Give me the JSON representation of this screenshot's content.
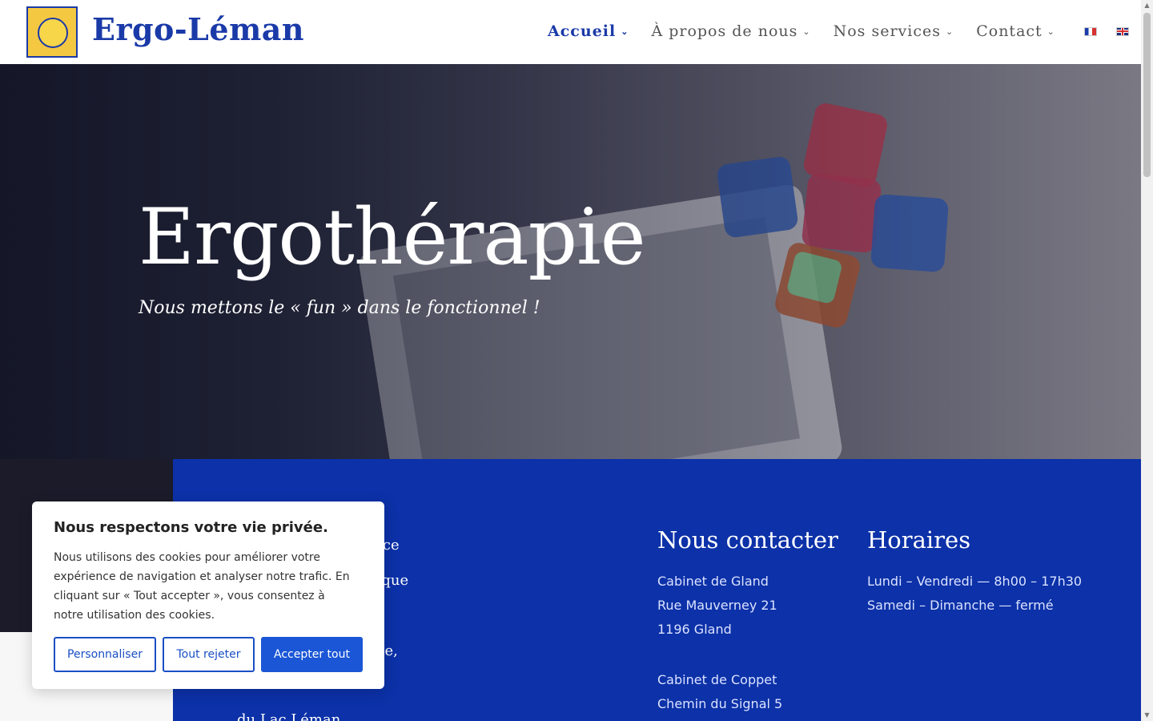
{
  "header": {
    "logo_text": "Ergo-Léman",
    "nav": [
      {
        "label": "Accueil",
        "active": true
      },
      {
        "label": "À propos de nous",
        "active": false
      },
      {
        "label": "Nos services",
        "active": false
      },
      {
        "label": "Contact",
        "active": false
      }
    ],
    "languages": [
      "fr-flag-icon",
      "en-flag-icon"
    ]
  },
  "hero": {
    "title": "Ergothérapie",
    "subtitle": "Nous mettons le « fun » dans le fonctionnel !"
  },
  "intro": {
    "fragments": [
      "vice",
      "rique",
      "sse,",
      "du Lac Léman."
    ]
  },
  "contact": {
    "title": "Nous contacter",
    "lines": [
      "Cabinet de Gland",
      "Rue Mauverney 21",
      "1196 Gland",
      "",
      "Cabinet de Coppet",
      "Chemin du Signal 5"
    ]
  },
  "hours": {
    "title": "Horaires",
    "lines": [
      "Lundi – Vendredi — 8h00 – 17h30",
      "Samedi – Dimanche — fermé"
    ]
  },
  "cookie": {
    "title": "Nous respectons votre vie privée.",
    "text": "Nous utilisons des cookies pour améliorer votre expérience de navigation et analyser notre trafic. En cliquant sur « Tout accepter », vous consentez à notre utilisation des cookies.",
    "customize_label": "Personnaliser",
    "reject_label": "Tout rejeter",
    "accept_label": "Accepter tout"
  },
  "colors": {
    "brand_blue": "#1a3aa8",
    "section_blue": "#0c31a8",
    "button_blue": "#1a56d6"
  }
}
